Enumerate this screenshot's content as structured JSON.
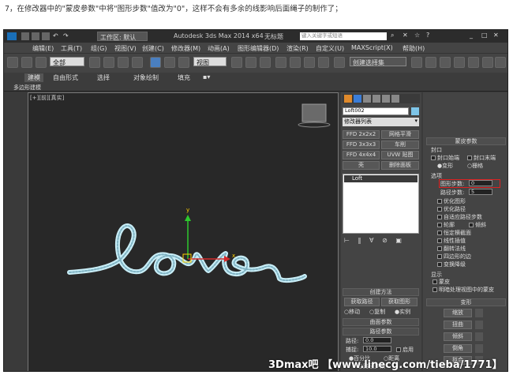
{
  "caption": "7，在修改器中的\"蒙皮参数\"中将\"图形步数\"值改为\"0\"，这样不会有多余的线影响后面绳子的制作了；",
  "titlebar": {
    "workspace": "工作区: 默认",
    "app_title": "Autodesk 3ds Max 2014 x64",
    "filename": "无标题",
    "search_placeholder": "键入关键字或短语"
  },
  "menu": [
    "编辑(E)",
    "工具(T)",
    "组(G)",
    "视图(V)",
    "创建(C)",
    "修改器(M)",
    "动画(A)",
    "图形编辑器(D)",
    "渲染(R)",
    "自定义(U)",
    "MAXScript(X)",
    "帮助(H)"
  ],
  "toolbar": {
    "filter": "全部",
    "ref_coord": "视图",
    "selection_set": "创建选择集"
  },
  "ribbon": {
    "tabs": [
      "建模",
      "自由形式",
      "选择",
      "对象绘制",
      "填充"
    ],
    "sub": "多边形建模"
  },
  "viewport": {
    "label": "[+][前][真实]",
    "text": "love"
  },
  "cmd": {
    "object_name": "Loft002",
    "modifier_list": "修改器列表",
    "buttons": [
      [
        "FFD 2x2x2",
        "网格平滑"
      ],
      [
        "FFD 3x3x3",
        "车削"
      ],
      [
        "FFD 4x4x4",
        "UVW 贴图"
      ],
      [
        "壳",
        "删除面板"
      ]
    ],
    "stack_item": "Loft",
    "create_method": {
      "header": "创建方法",
      "get_path": "获取路径",
      "get_shape": "获取图形",
      "move": "移动",
      "copy": "复制",
      "instance": "实例"
    },
    "surface_params": "曲面参数",
    "path_params": {
      "header": "路径参数",
      "path_label": "路径:",
      "path_value": "0.0",
      "snap_label": "捕捉:",
      "snap_value": "10.0",
      "enable": "启用",
      "percent": "百分比",
      "distance": "距离",
      "path_steps": "路径步数"
    }
  },
  "skin": {
    "header": "蒙皮参数",
    "capping": "封口",
    "cap_start": "封口始端",
    "cap_end": "封口末端",
    "morph": "变形",
    "grid": "栅格",
    "options": "选项",
    "shape_steps_label": "图形步数:",
    "shape_steps_value": "0",
    "path_steps_label": "路径步数:",
    "path_steps_value": "5",
    "checks": [
      "优化图形",
      "优化路径",
      "自适应路径步数",
      "轮廓",
      "倾斜",
      "恒定横截面",
      "线性插值",
      "翻转法线",
      "四边形的边",
      "变换降级"
    ],
    "display": "显示",
    "skin_check": "蒙皮",
    "skin_shaded": "明暗处理视图中的蒙皮"
  },
  "deform": {
    "header": "变形",
    "items": [
      "缩放",
      "扭曲",
      "倾斜",
      "倒角",
      "拟合"
    ]
  },
  "watermark": "3Dmax吧 【www.linecg.com/tieba/1771】"
}
